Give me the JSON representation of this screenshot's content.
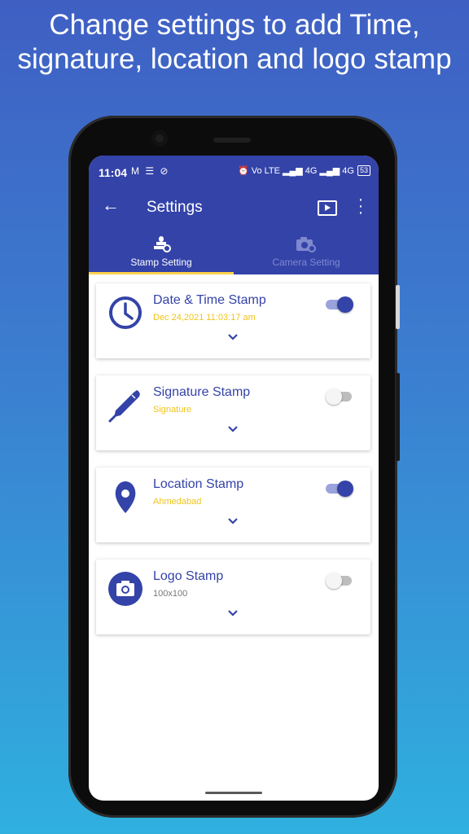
{
  "headline": "Change settings to add Time, signature, location and logo stamp",
  "status_bar": {
    "time": "11:04",
    "left_icons": "M ☰ ⊘",
    "right_icons": "⏰ Vo LTE ▂▄▆ 4G ▂▄▆ 4G",
    "battery": "53"
  },
  "app_bar": {
    "title": "Settings",
    "back_icon": "arrow-left-icon",
    "actions": [
      "play-video-icon",
      "more-vert-icon"
    ]
  },
  "tabs": [
    {
      "label": "Stamp Setting",
      "icon": "stamp-gear-icon",
      "active": true
    },
    {
      "label": "Camera Setting",
      "icon": "camera-gear-icon",
      "active": false
    }
  ],
  "stamps": [
    {
      "title": "Date & Time Stamp",
      "subtitle": "Dec 24,2021 11:03:17 am",
      "icon": "clock-icon",
      "enabled": true
    },
    {
      "title": "Signature Stamp",
      "subtitle": "Signature",
      "icon": "pen-icon",
      "enabled": false
    },
    {
      "title": "Location Stamp",
      "subtitle": "Ahmedabad",
      "icon": "location-pin-icon",
      "enabled": true
    },
    {
      "title": "Logo Stamp",
      "subtitle": "100x100",
      "icon": "camera-icon",
      "enabled": false
    }
  ],
  "colors": {
    "primary": "#3443a8",
    "accent_yellow": "#f0c419",
    "tab_indicator": "#ffd24a"
  }
}
